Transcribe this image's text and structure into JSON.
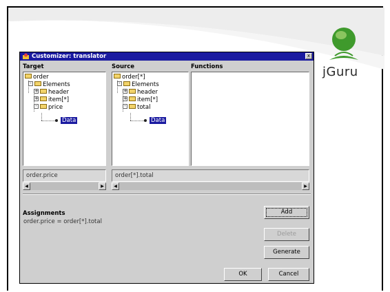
{
  "logo": {
    "text": "jGuru",
    "colors": {
      "green": "#3f9a2c",
      "light_green": "#9fd06d"
    }
  },
  "dialog": {
    "title": "Customizer: translator",
    "close_label": "x",
    "target": {
      "label": "Target",
      "tree": [
        {
          "label": "order",
          "indent": 0,
          "expander": ""
        },
        {
          "label": "Elements",
          "indent": 1,
          "expander": "-"
        },
        {
          "label": "header",
          "indent": 2,
          "expander": "+"
        },
        {
          "label": "item[*]",
          "indent": 2,
          "expander": "+"
        },
        {
          "label": "price",
          "indent": 2,
          "expander": "-"
        },
        {
          "label": "Data",
          "indent": 3,
          "expander": "",
          "selected": true
        }
      ],
      "path": "order.price"
    },
    "source": {
      "label": "Source",
      "tree": [
        {
          "label": "order[*]",
          "indent": 0,
          "expander": ""
        },
        {
          "label": "Elements",
          "indent": 1,
          "expander": "-"
        },
        {
          "label": "header",
          "indent": 2,
          "expander": "+"
        },
        {
          "label": "item[*]",
          "indent": 2,
          "expander": "+"
        },
        {
          "label": "total",
          "indent": 2,
          "expander": "-"
        },
        {
          "label": "Data",
          "indent": 3,
          "expander": "",
          "selected": true
        }
      ],
      "path": "order[*].total"
    },
    "functions": {
      "label": "Functions"
    },
    "assignments": {
      "label": "Assignments",
      "items": [
        "order.price = order[*].total"
      ]
    },
    "buttons": {
      "add": "Add",
      "delete": "Delete",
      "generate": "Generate",
      "ok": "OK",
      "cancel": "Cancel"
    }
  }
}
